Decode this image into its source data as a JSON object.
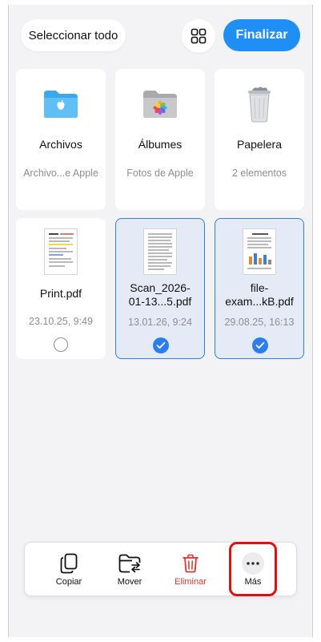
{
  "header": {
    "select_all": "Seleccionar todo",
    "grid_icon": "grid-icon",
    "done": "Finalizar"
  },
  "items": [
    {
      "title": "Archivos",
      "subtitle": "Archivo...e Apple",
      "icon": "icloud-folder-icon"
    },
    {
      "title": "Álbumes",
      "subtitle": "Fotos de Apple",
      "icon": "photos-folder-icon"
    },
    {
      "title": "Papelera",
      "subtitle": "2 elementos",
      "icon": "trash-bin-icon"
    },
    {
      "title": "Print.pdf",
      "subtitle": "23.10.25, 9:49",
      "selected": false
    },
    {
      "title": "Scan_2026-01-13...5.pdf",
      "title_line1": "Scan_2026-",
      "title_line2": "01-13...5.pdf",
      "subtitle": "13.01.26, 9:24",
      "selected": true
    },
    {
      "title": "file-exam...kB.pdf",
      "title_line1": "file-",
      "title_line2": "exam...kB.pdf",
      "subtitle": "29.08.25, 16:13",
      "selected": true
    }
  ],
  "toolbar": {
    "copy": "Copiar",
    "move": "Mover",
    "delete": "Eliminar",
    "more": "Más"
  },
  "colors": {
    "accent": "#1f8ff5",
    "danger": "#e0322f",
    "highlight": "#e01010"
  }
}
